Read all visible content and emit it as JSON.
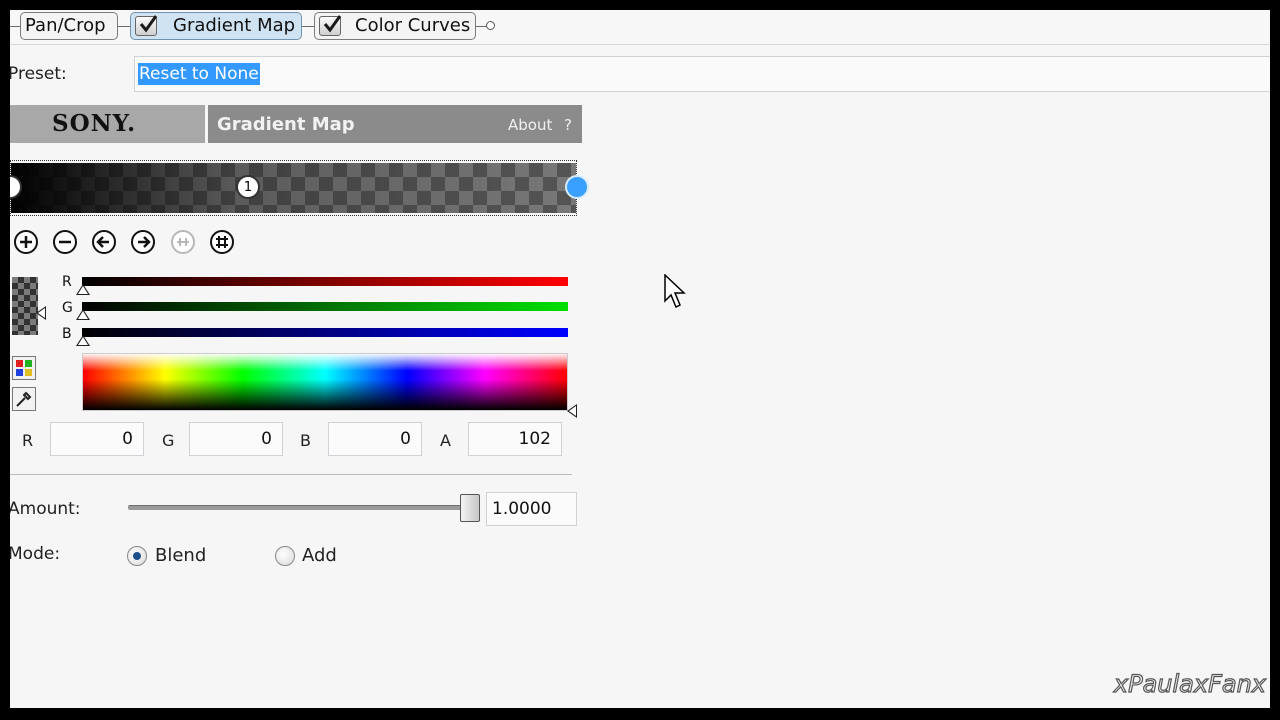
{
  "chain": {
    "tabs": [
      {
        "label": "Pan/Crop",
        "active": false,
        "has_check": false
      },
      {
        "label": "Gradient Map",
        "active": true,
        "has_check": true
      },
      {
        "label": "Color Curves",
        "active": false,
        "has_check": true
      }
    ]
  },
  "preset": {
    "label": "Preset:",
    "value": "Reset to None"
  },
  "header": {
    "brand": "SONY.",
    "title": "Gradient Map",
    "about": "About",
    "help": "?"
  },
  "gradient": {
    "stops": [
      "",
      "1",
      ""
    ]
  },
  "toolbar": {
    "icons": [
      "add-stop-icon",
      "remove-stop-icon",
      "move-left-icon",
      "move-right-icon",
      "distribute-icon",
      "reverse-stops-icon"
    ]
  },
  "channels": {
    "r": "R",
    "g": "G",
    "b": "B"
  },
  "values": {
    "r_label": "R",
    "r": "0",
    "g_label": "G",
    "g": "0",
    "b_label": "B",
    "b": "0",
    "a_label": "A",
    "a": "102"
  },
  "amount": {
    "label": "Amount:",
    "value": "1.0000",
    "level": 1.0
  },
  "mode": {
    "label": "Mode:",
    "options": [
      "Blend",
      "Add"
    ],
    "selected": "Blend"
  },
  "watermark": "xPaulaxFanx",
  "colors": {
    "selection": "#3399ff",
    "active_tab": "#cfe3f3",
    "title_bar": "#8b8b8b"
  }
}
